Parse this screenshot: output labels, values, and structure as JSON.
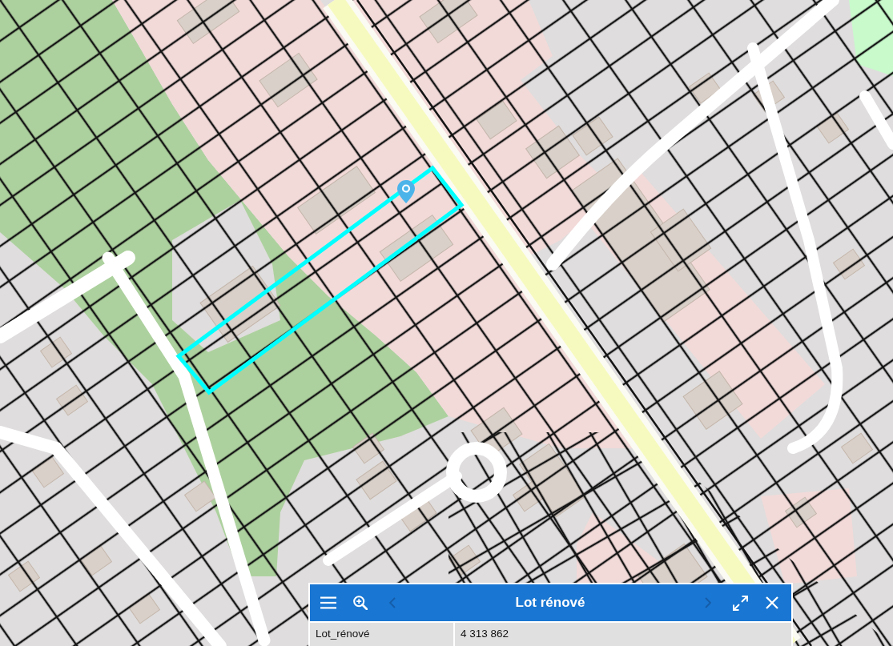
{
  "popup": {
    "title": "Lot rénové",
    "previous": {
      "disabled": true
    },
    "next": {
      "disabled": true
    },
    "rows": [
      {
        "label": "Lot_rénové",
        "value": "4 313 862"
      }
    ]
  }
}
